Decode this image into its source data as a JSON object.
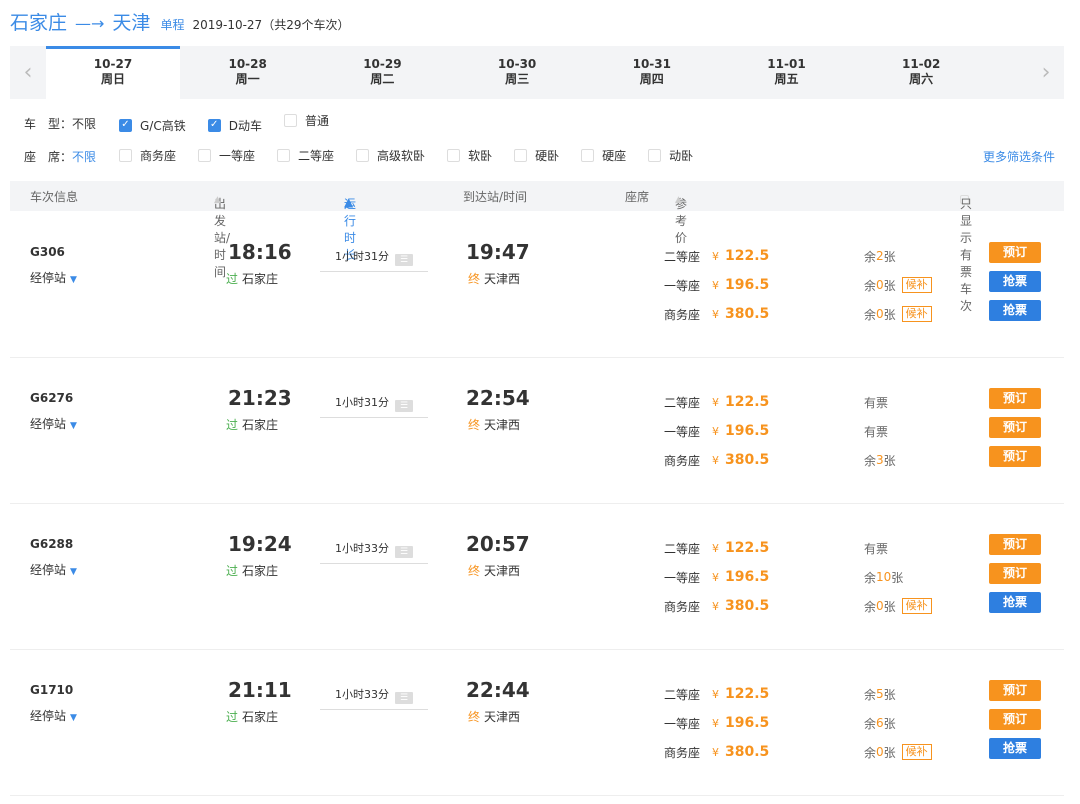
{
  "route": {
    "from": "石家庄",
    "arrow": "—→",
    "to": "天津",
    "trip_type": "单程",
    "meta": "2019-10-27（共29个车次）"
  },
  "date_nav": {
    "prev_icon": "chevron-left-icon",
    "next_icon": "chevron-right-icon",
    "dates": [
      {
        "date": "10-27",
        "day": "周日",
        "active": true
      },
      {
        "date": "10-28",
        "day": "周一"
      },
      {
        "date": "10-29",
        "day": "周二"
      },
      {
        "date": "10-30",
        "day": "周三"
      },
      {
        "date": "10-31",
        "day": "周四"
      },
      {
        "date": "11-01",
        "day": "周五"
      },
      {
        "date": "11-02",
        "day": "周六"
      }
    ]
  },
  "filters": {
    "train_type": {
      "label": "车　型：",
      "value": "不限",
      "options": [
        {
          "label": "G/C高铁",
          "checked": true
        },
        {
          "label": "D动车",
          "checked": true
        },
        {
          "label": "普通",
          "checked": false
        }
      ]
    },
    "seat_type": {
      "label": "座　席：",
      "value": "不限",
      "options": [
        {
          "label": "商务座",
          "checked": false
        },
        {
          "label": "一等座",
          "checked": false
        },
        {
          "label": "二等座",
          "checked": false
        },
        {
          "label": "高级软卧",
          "checked": false
        },
        {
          "label": "软卧",
          "checked": false
        },
        {
          "label": "硬卧",
          "checked": false
        },
        {
          "label": "硬座",
          "checked": false
        },
        {
          "label": "动卧",
          "checked": false
        }
      ]
    },
    "more": "更多筛选条件"
  },
  "table_header": {
    "train_info": "车次信息",
    "departure": "出发站/时间",
    "duration": "运行时长",
    "arrival": "到达站/时间",
    "seat": "座席",
    "price": "参考价",
    "only_available": "只显示有票车次"
  },
  "trains": [
    {
      "number": "G306",
      "stops_label": "经停站",
      "dep_time": "18:16",
      "dep_tag": "过",
      "dep_station": "石家庄",
      "duration": "1小时31分",
      "arr_time": "19:47",
      "arr_tag": "终",
      "arr_station": "天津西",
      "seats": [
        {
          "name": "二等座",
          "price": "122.5",
          "avail_prefix": "余",
          "avail_num": "2",
          "avail_suffix": "张",
          "waitlist": "",
          "button": "预订",
          "button_color": "#f7931e"
        },
        {
          "name": "一等座",
          "price": "196.5",
          "avail_prefix": "余",
          "avail_num": "0",
          "avail_suffix": "张",
          "waitlist": "候补",
          "button": "抢票",
          "button_color": "#2e7fe0"
        },
        {
          "name": "商务座",
          "price": "380.5",
          "avail_prefix": "余",
          "avail_num": "0",
          "avail_suffix": "张",
          "waitlist": "候补",
          "button": "抢票",
          "button_color": "#2e7fe0"
        }
      ]
    },
    {
      "number": "G6276",
      "stops_label": "经停站",
      "dep_time": "21:23",
      "dep_tag": "过",
      "dep_station": "石家庄",
      "duration": "1小时31分",
      "arr_time": "22:54",
      "arr_tag": "终",
      "arr_station": "天津西",
      "seats": [
        {
          "name": "二等座",
          "price": "122.5",
          "avail_prefix": "有票",
          "avail_num": "",
          "avail_suffix": "",
          "waitlist": "",
          "button": "预订",
          "button_color": "#f7931e"
        },
        {
          "name": "一等座",
          "price": "196.5",
          "avail_prefix": "有票",
          "avail_num": "",
          "avail_suffix": "",
          "waitlist": "",
          "button": "预订",
          "button_color": "#f7931e"
        },
        {
          "name": "商务座",
          "price": "380.5",
          "avail_prefix": "余",
          "avail_num": "3",
          "avail_suffix": "张",
          "waitlist": "",
          "button": "预订",
          "button_color": "#f7931e"
        }
      ]
    },
    {
      "number": "G6288",
      "stops_label": "经停站",
      "dep_time": "19:24",
      "dep_tag": "过",
      "dep_station": "石家庄",
      "duration": "1小时33分",
      "arr_time": "20:57",
      "arr_tag": "终",
      "arr_station": "天津西",
      "seats": [
        {
          "name": "二等座",
          "price": "122.5",
          "avail_prefix": "有票",
          "avail_num": "",
          "avail_suffix": "",
          "waitlist": "",
          "button": "预订",
          "button_color": "#f7931e"
        },
        {
          "name": "一等座",
          "price": "196.5",
          "avail_prefix": "余",
          "avail_num": "10",
          "avail_suffix": "张",
          "waitlist": "",
          "button": "预订",
          "button_color": "#f7931e"
        },
        {
          "name": "商务座",
          "price": "380.5",
          "avail_prefix": "余",
          "avail_num": "0",
          "avail_suffix": "张",
          "waitlist": "候补",
          "button": "抢票",
          "button_color": "#2e7fe0"
        }
      ]
    },
    {
      "number": "G1710",
      "stops_label": "经停站",
      "dep_time": "21:11",
      "dep_tag": "过",
      "dep_station": "石家庄",
      "duration": "1小时33分",
      "arr_time": "22:44",
      "arr_tag": "终",
      "arr_station": "天津西",
      "seats": [
        {
          "name": "二等座",
          "price": "122.5",
          "avail_prefix": "余",
          "avail_num": "5",
          "avail_suffix": "张",
          "waitlist": "",
          "button": "预订",
          "button_color": "#f7931e"
        },
        {
          "name": "一等座",
          "price": "196.5",
          "avail_prefix": "余",
          "avail_num": "6",
          "avail_suffix": "张",
          "waitlist": "",
          "button": "预订",
          "button_color": "#f7931e"
        },
        {
          "name": "商务座",
          "price": "380.5",
          "avail_prefix": "余",
          "avail_num": "0",
          "avail_suffix": "张",
          "waitlist": "候补",
          "button": "抢票",
          "button_color": "#2e7fe0"
        }
      ]
    }
  ]
}
